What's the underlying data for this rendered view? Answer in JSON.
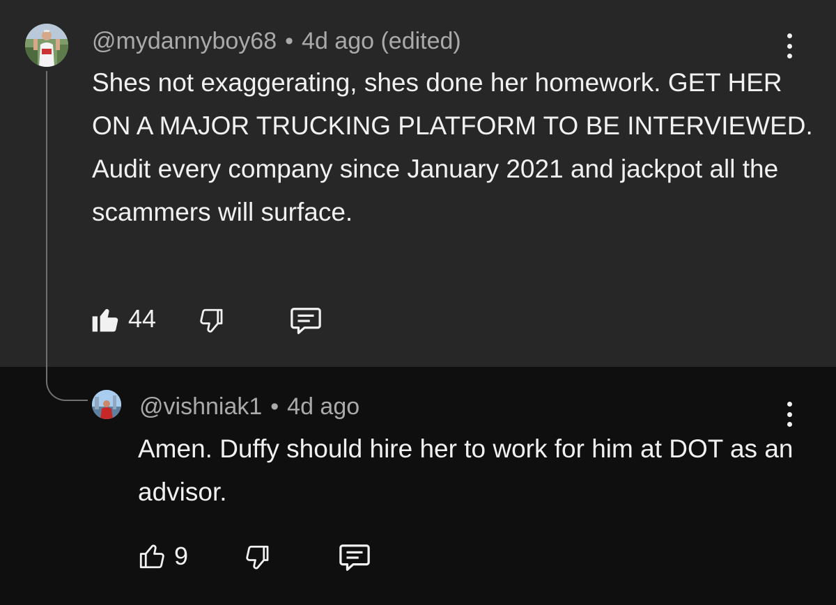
{
  "colors": {
    "main_bg": "#272727",
    "reply_bg": "#0f0f0f",
    "text": "#f1f1f1",
    "meta": "#aaaaaa"
  },
  "comments": [
    {
      "author": "@mydannyboy68",
      "separator": "•",
      "time": "4d ago (edited)",
      "text": "Shes not exaggerating, shes done her homework. GET HER ON A MAJOR TRUCKING PLATFORM TO BE INTERVIEWED. Audit every company since January 2021 and jackpot all the scammers will surface.",
      "likes": "44",
      "like_icon": "thumbs-up-filled-icon",
      "dislike_icon": "thumbs-down-icon",
      "reply_icon": "reply-comment-icon",
      "menu_icon": "more-vert-icon"
    },
    {
      "author": "@vishniak1",
      "separator": "•",
      "time": "4d ago",
      "text": "Amen. Duffy should hire her to work for him at DOT as an advisor.",
      "likes": "9",
      "like_icon": "thumbs-up-outline-icon",
      "dislike_icon": "thumbs-down-icon",
      "reply_icon": "reply-comment-icon",
      "menu_icon": "more-vert-icon"
    }
  ]
}
